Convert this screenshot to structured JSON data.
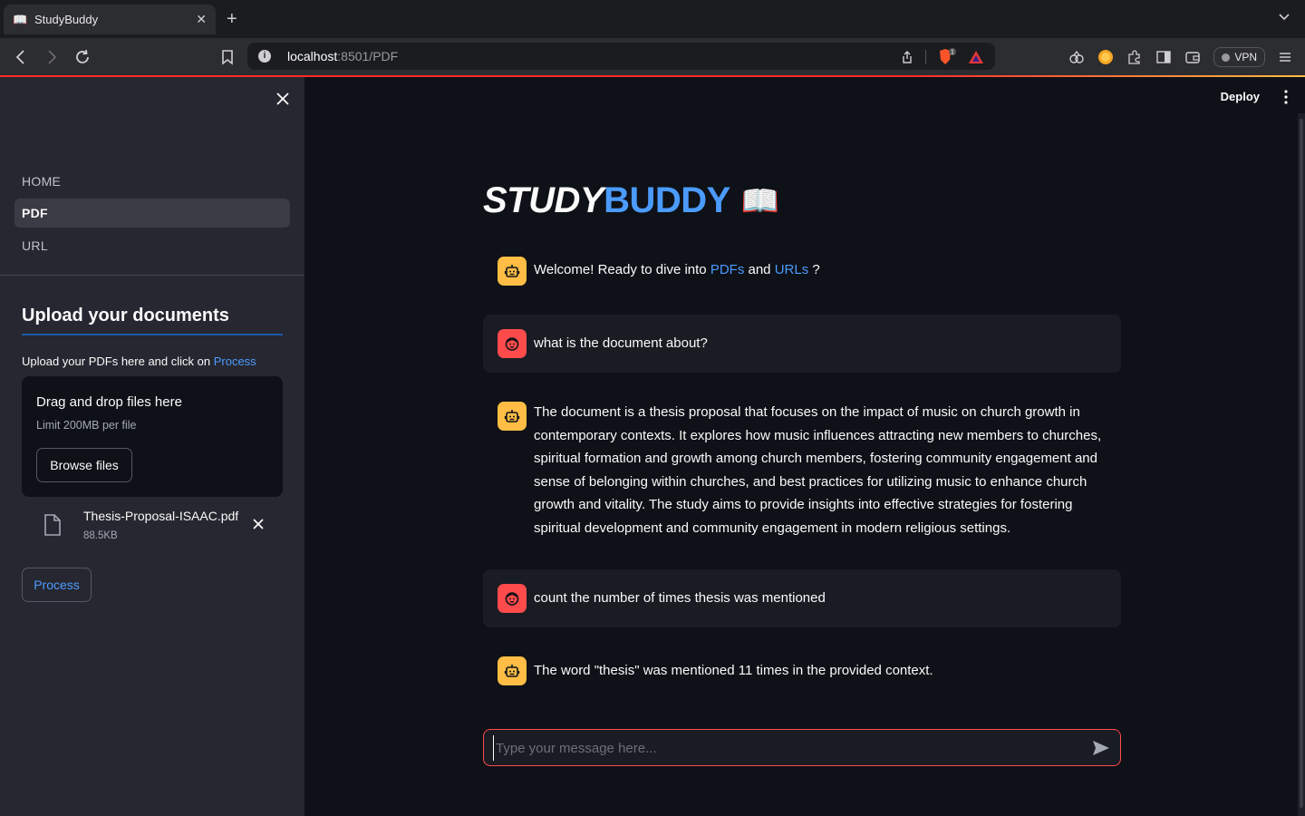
{
  "browser": {
    "tab_title": "StudyBuddy",
    "url_host": "localhost",
    "url_path": ":8501/PDF",
    "vpn_label": "VPN",
    "shield_badge": "1"
  },
  "sidebar": {
    "nav": [
      {
        "label": "HOME",
        "active": false
      },
      {
        "label": "PDF",
        "active": true
      },
      {
        "label": "URL",
        "active": false
      }
    ],
    "heading": "Upload your documents",
    "caption_prefix": "Upload your PDFs here and click on ",
    "caption_accent": "Process",
    "dropzone_title": "Drag and drop files here",
    "dropzone_limit": "Limit 200MB per file",
    "browse_label": "Browse files",
    "file": {
      "name": "Thesis-Proposal-ISAAC.pdf",
      "size": "88.5KB"
    },
    "process_label": "Process"
  },
  "header": {
    "deploy_label": "Deploy"
  },
  "main": {
    "title_part1": "STUDY",
    "title_part2": "BUDDY",
    "title_emoji": "📖",
    "welcome": {
      "prefix": "Welcome! Ready to dive into ",
      "link1": "PDFs",
      "middle": " and ",
      "link2": "URLs",
      "suffix": " ?"
    },
    "messages": [
      {
        "role": "user",
        "text": "what is the document about?"
      },
      {
        "role": "assistant",
        "text": "The document is a thesis proposal that focuses on the impact of music on church growth in contemporary contexts. It explores how music influences attracting new members to churches, spiritual formation and growth among church members, fostering community engagement and sense of belonging within churches, and best practices for utilizing music to enhance church growth and vitality. The study aims to provide insights into effective strategies for fostering spiritual development and community engagement in modern religious settings."
      },
      {
        "role": "user",
        "text": "count the number of times thesis was mentioned"
      },
      {
        "role": "assistant",
        "text": "The word \"thesis\" was mentioned 11 times in the provided context."
      }
    ],
    "input_placeholder": "Type your message here..."
  },
  "colors": {
    "accent": "#4b9bff",
    "bot_avatar": "#ffbd45",
    "user_avatar": "#ff4b4b",
    "sidebar_bg": "#262730",
    "main_bg": "#0e1117"
  }
}
